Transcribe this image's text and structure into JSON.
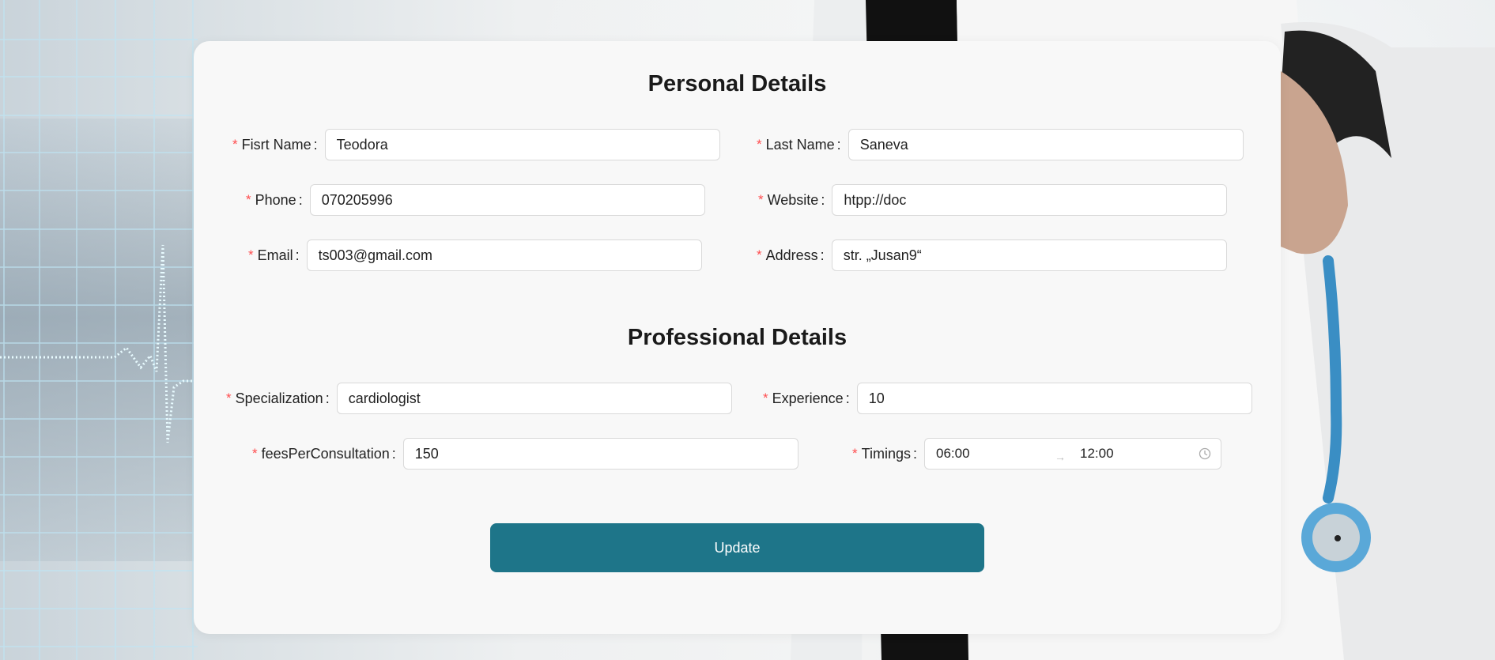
{
  "personal": {
    "title": "Personal Details",
    "first_name": {
      "label": "Fisrt Name",
      "value": "Teodora"
    },
    "last_name": {
      "label": "Last Name",
      "value": "Saneva"
    },
    "phone": {
      "label": "Phone",
      "value": "070205996"
    },
    "website": {
      "label": "Website",
      "value": "htpp://doc"
    },
    "email": {
      "label": "Email",
      "value": "ts003@gmail.com"
    },
    "address": {
      "label": "Address",
      "value": "str. „Jusan9“"
    }
  },
  "professional": {
    "title": "Professional Details",
    "specialization": {
      "label": "Specialization",
      "value": "cardiologist"
    },
    "experience": {
      "label": "Experience",
      "value": "10"
    },
    "fees": {
      "label": "feesPerConsultation",
      "value": "150"
    },
    "timings": {
      "label": "Timings",
      "start": "06:00",
      "end": "12:00",
      "separator": "→",
      "icon": "clock-icon"
    }
  },
  "actions": {
    "update_label": "Update"
  },
  "colors": {
    "accent": "#1e7589",
    "required": "#ff4d4f",
    "card": "#f8f8f8"
  }
}
